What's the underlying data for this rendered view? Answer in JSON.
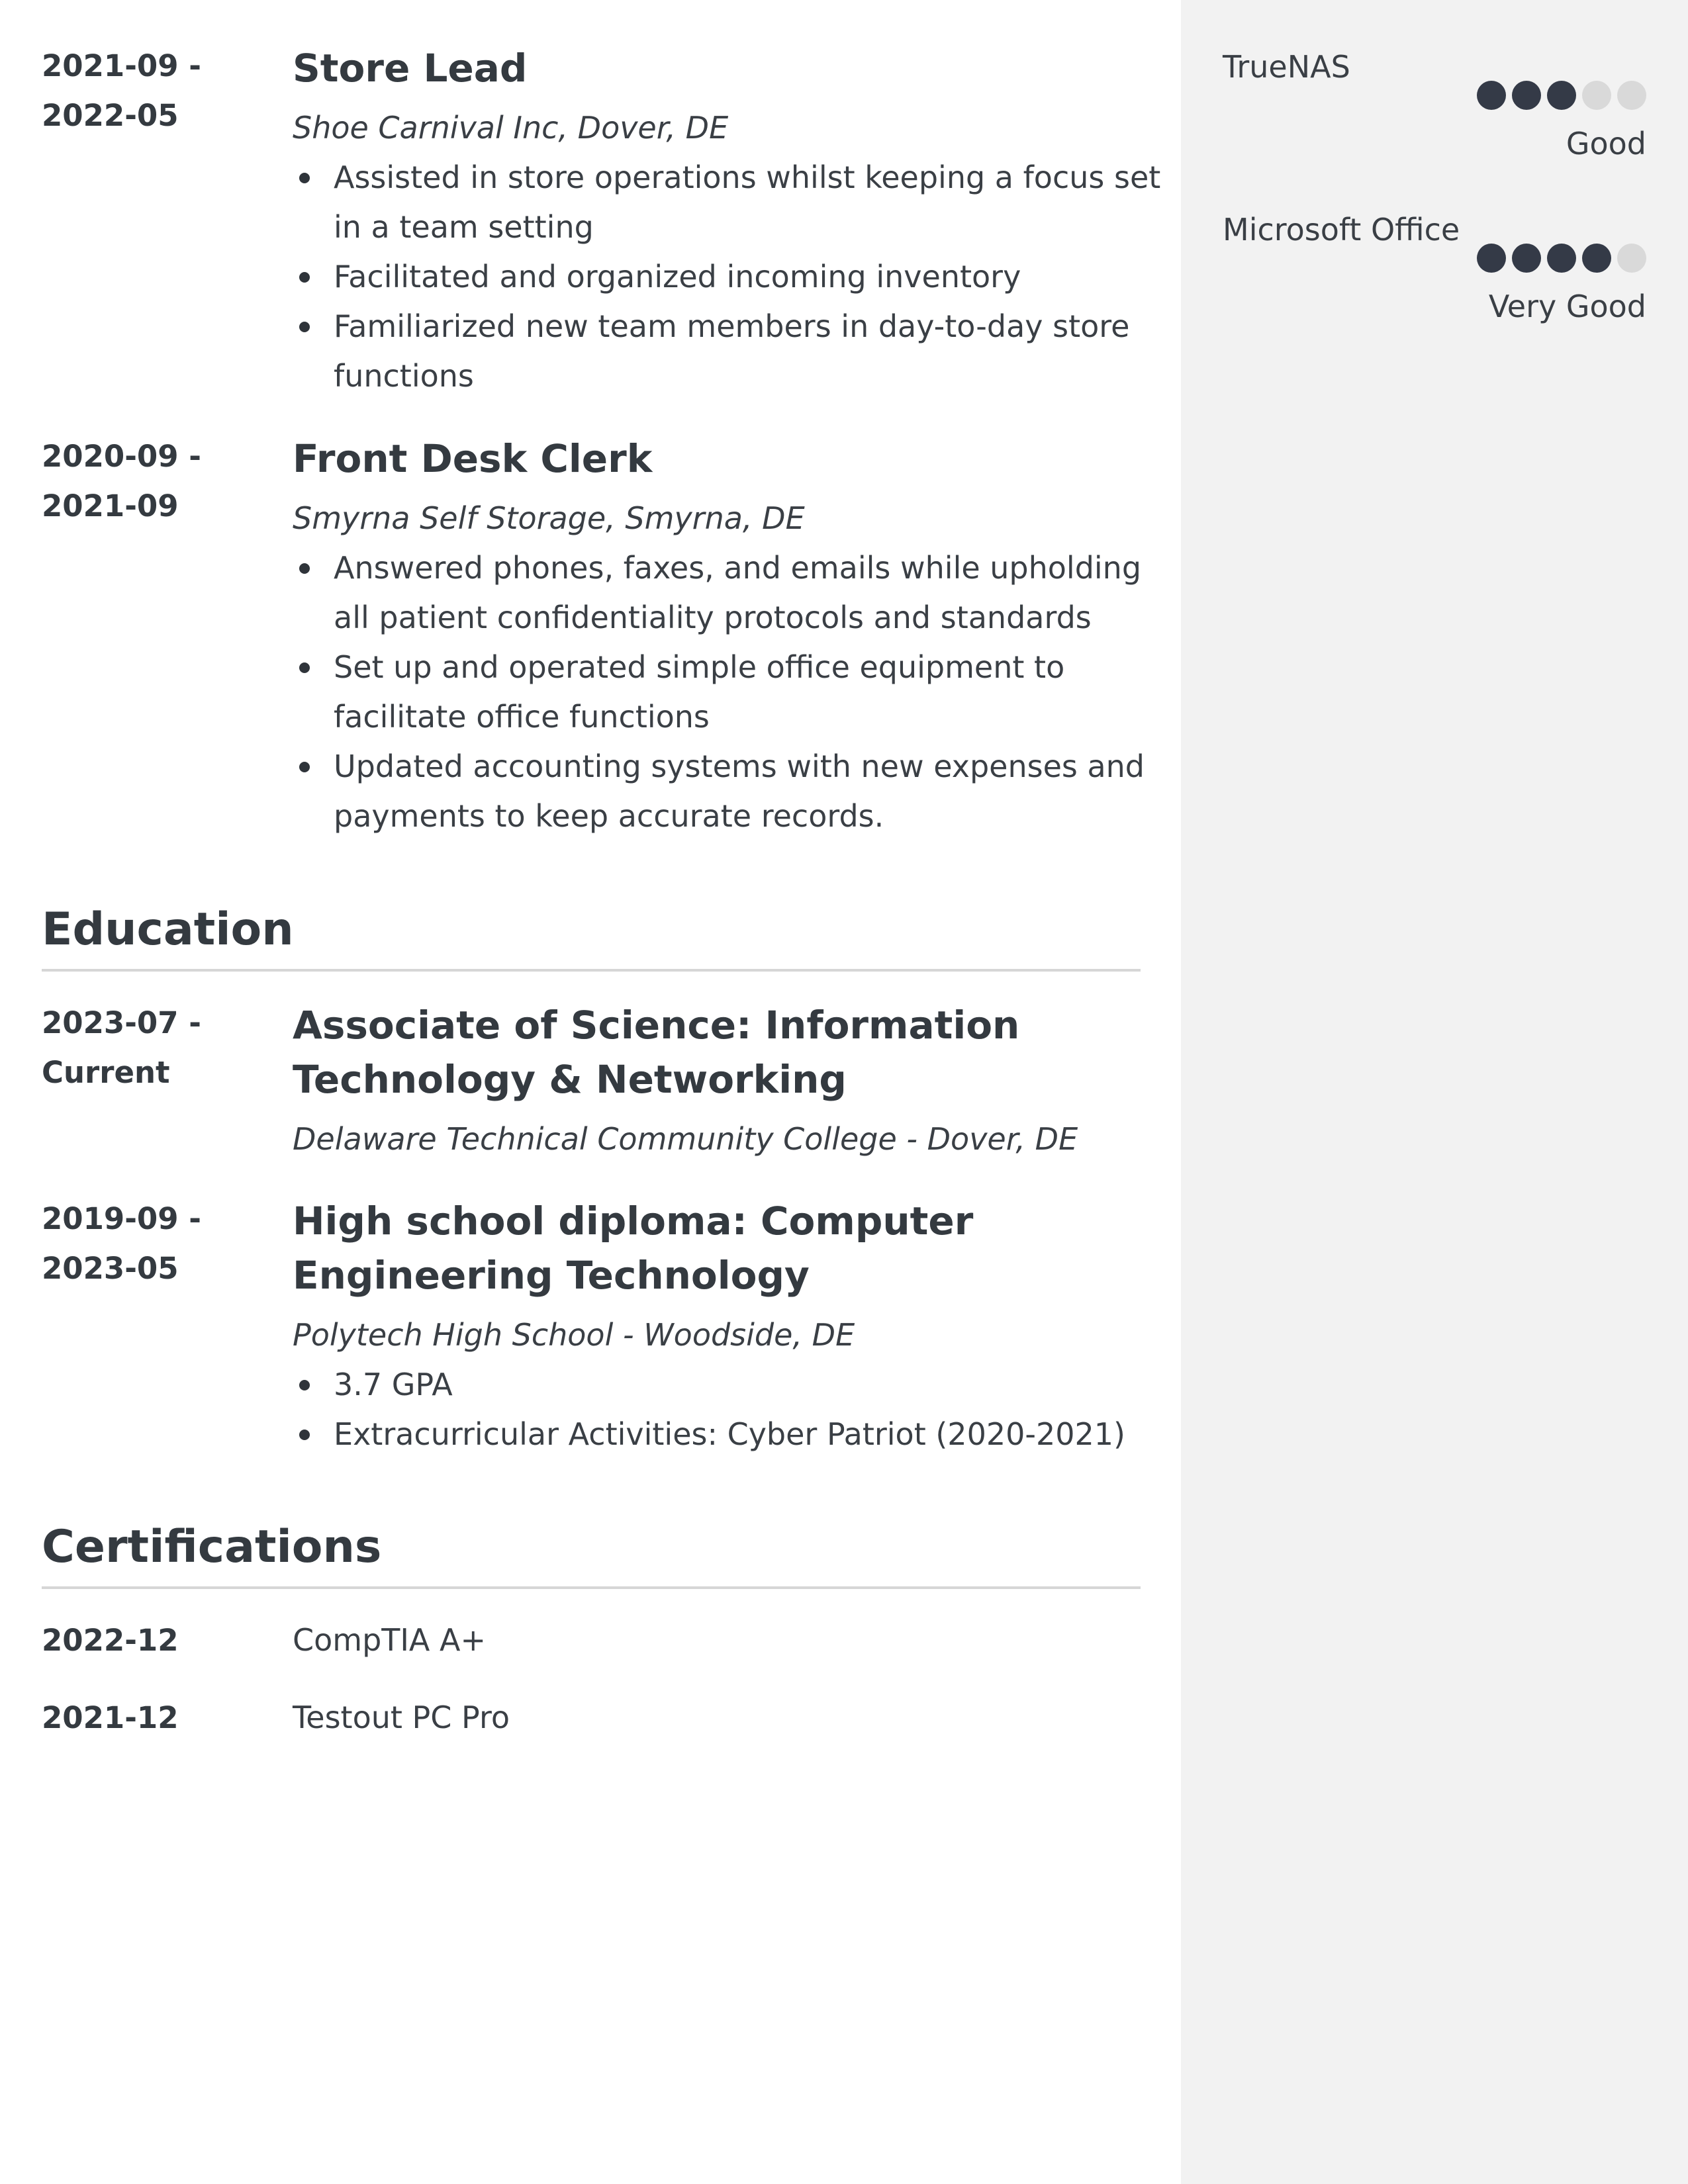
{
  "experience": [
    {
      "date_start": "2021-09 -",
      "date_end": "2022-05",
      "title": "Store Lead",
      "company": "Shoe Carnival Inc, Dover, DE",
      "bullets": [
        "Assisted in store operations whilst keeping a focus set in a team setting",
        "Facilitated and organized incoming inventory",
        "Familiarized new team members in day-to-day store functions"
      ]
    },
    {
      "date_start": "2020-09 -",
      "date_end": "2021-09",
      "title": "Front Desk Clerk",
      "company": "Smyrna Self Storage, Smyrna, DE",
      "bullets": [
        "Answered phones, faxes, and emails while upholding all patient confidentiality protocols and standards",
        "Set up and operated simple office equipment to facilitate office functions",
        "Updated accounting systems with new expenses and payments to keep accurate records."
      ]
    }
  ],
  "education_heading": "Education",
  "education": [
    {
      "date_start": "2023-07 -",
      "date_end": "Current",
      "title": "Associate of Science: Information Technology & Networking",
      "school": "Delaware Technical Community College - Dover, DE",
      "bullets": []
    },
    {
      "date_start": "2019-09 -",
      "date_end": "2023-05",
      "title": "High school diploma: Computer Engineering Technology",
      "school": "Polytech High School - Woodside, DE",
      "bullets": [
        "3.7 GPA",
        "Extracurricular Activities: Cyber Patriot (2020-2021)"
      ]
    }
  ],
  "certifications_heading": "Certifications",
  "certifications": [
    {
      "date": "2022-12",
      "name": "CompTIA A+"
    },
    {
      "date": "2021-12",
      "name": "Testout PC Pro"
    }
  ],
  "skills": [
    {
      "name": "TrueNAS",
      "level_label": "Good",
      "level": 3,
      "max": 5
    },
    {
      "name": "Microsoft Office",
      "level_label": "Very Good",
      "level": 4,
      "max": 5
    }
  ],
  "colors": {
    "text": "#343a40",
    "sidebar_bg": "#f2f2f2",
    "dot_on": "#343a47",
    "dot_off": "#d9d9d9",
    "rule": "#d6d6d6"
  }
}
